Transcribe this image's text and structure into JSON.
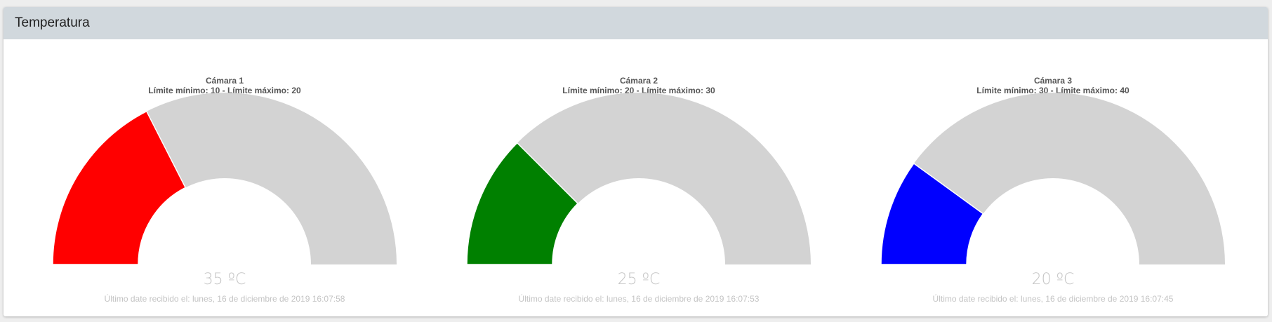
{
  "panel": {
    "title": "Temperatura"
  },
  "gauges": [
    {
      "name": "Cámara 1",
      "limits": "Límite mínimo: 10 - Límite máximo: 20",
      "value_text": "35 ºC",
      "value": 35,
      "min": 0,
      "max": 100,
      "color": "#ff0000",
      "footer": "Último date recibido el: lunes, 16 de diciembre de 2019 16:07:58"
    },
    {
      "name": "Cámara 2",
      "limits": "Límite mínimo: 20 - Límite máximo: 30",
      "value_text": "25 ºC",
      "value": 25,
      "min": 0,
      "max": 100,
      "color": "#008000",
      "footer": "Último date recibido el: lunes, 16 de diciembre de 2019 16:07:53"
    },
    {
      "name": "Cámara 3",
      "limits": "Límite mínimo: 30 - Límite máximo: 40",
      "value_text": "20 ºC",
      "value": 20,
      "min": 0,
      "max": 100,
      "color": "#0000ff",
      "footer": "Último date recibido el: lunes, 16 de diciembre de 2019 16:07:45"
    }
  ],
  "track_color": "#d3d3d3"
}
